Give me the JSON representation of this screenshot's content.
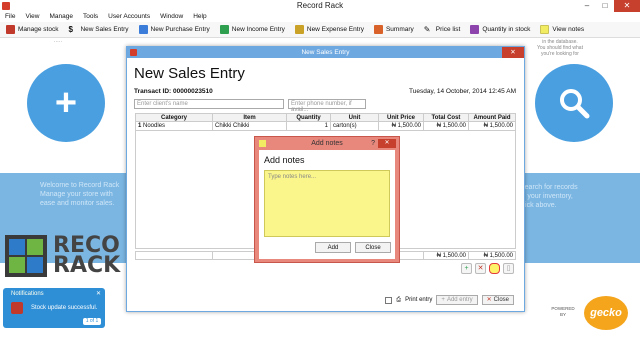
{
  "window": {
    "title": "Record Rack"
  },
  "menu": [
    "File",
    "View",
    "Manage",
    "Tools",
    "User Accounts",
    "Window",
    "Help"
  ],
  "toolbar": [
    {
      "label": "Manage stock",
      "icon": "box-icon",
      "color": "#c0392b"
    },
    {
      "label": "New Sales Entry",
      "icon": "dollar-icon",
      "color": "#222222"
    },
    {
      "label": "New Purchase Entry",
      "icon": "cart-icon",
      "color": "#3b7dd8"
    },
    {
      "label": "New Income Entry",
      "icon": "arrow-icon",
      "color": "#2e9e4f"
    },
    {
      "label": "New Expense Entry",
      "icon": "money-icon",
      "color": "#c9a227"
    },
    {
      "label": "Summary",
      "icon": "chart-icon",
      "color": "#d9622b"
    },
    {
      "label": "Price list",
      "icon": "tag-icon",
      "color": "#444444"
    },
    {
      "label": "Quantity in stock",
      "icon": "stock-icon",
      "color": "#8e44ad"
    },
    {
      "label": "View notes",
      "icon": "note-icon",
      "color": "#f1ec61"
    }
  ],
  "background": {
    "left_circle_icon": "plus-icon",
    "right_circle_icon": "search-icon",
    "right_side_note": "in the database.\nYou should find what\nyou're looking for",
    "band_text_left": "Welcome to Record Rack\nManage your store with\nease and monitor sales.",
    "band_text_right": "Search for records\nin your inventory,\nclick above.",
    "logo_word_1": "RECO",
    "logo_word_2": "RACK"
  },
  "notification": {
    "title": "Notifications",
    "message": "Stock update successful.",
    "button": "1 of 1"
  },
  "powered_by": "POWERED BY",
  "brand": "gecko",
  "sales_dialog": {
    "title": "New Sales Entry",
    "heading": "New Sales Entry",
    "transaction_label": "Transact ID: 00000023510",
    "date": "Tuesday, 14 October, 2014   12:45 AM",
    "client_placeholder": "Enter client's name",
    "phone_placeholder": "Enter phone number, if avail...",
    "columns": [
      "Category",
      "Item",
      "Quantity",
      "Unit",
      "Unit Price",
      "Total Cost",
      "Amount Paid"
    ],
    "rows": [
      {
        "num": "1",
        "category": "Noodles",
        "item": "Chikki Chikki",
        "quantity": "1",
        "unit": "carton(s)",
        "unit_price": "₦ 1,500.00",
        "total_cost": "₦ 1,500.00",
        "amount_paid": "₦ 1,500.00"
      }
    ],
    "totals": {
      "total_cost": "₦ 1,500.00",
      "amount_paid": "₦ 1,500.00"
    },
    "print_entry": "Print entry",
    "add_entry": "Add entry",
    "close": "Close"
  },
  "notes_dialog": {
    "title": "Add notes",
    "heading": "Add notes",
    "placeholder": "Type notes here...",
    "add_button": "Add",
    "close_button": "Close",
    "help": "?"
  }
}
